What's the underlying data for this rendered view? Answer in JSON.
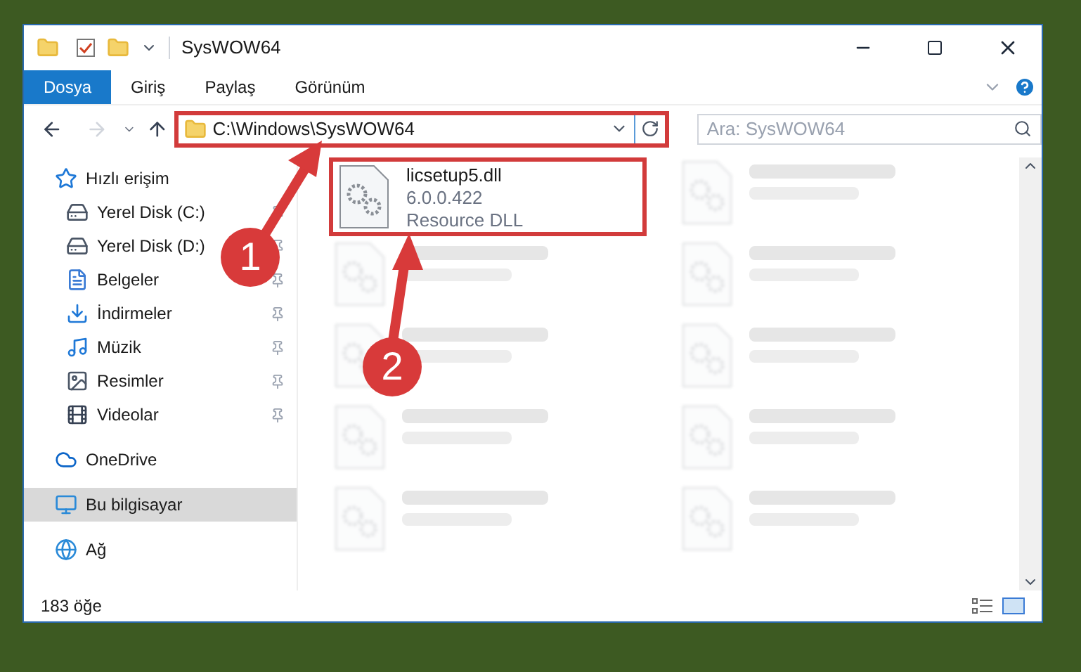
{
  "window": {
    "title": "SysWOW64"
  },
  "ribbon_tabs": [
    {
      "label": "Dosya",
      "selected": true
    },
    {
      "label": "Giriş",
      "selected": false
    },
    {
      "label": "Paylaş",
      "selected": false
    },
    {
      "label": "Görünüm",
      "selected": false
    }
  ],
  "address": {
    "path": "C:\\Windows\\SysWOW64",
    "highlighted": true
  },
  "search": {
    "placeholder": "Ara: SysWOW64"
  },
  "sidebar": {
    "items": [
      {
        "label": "Hızlı erişim",
        "kind": "star",
        "selected": false,
        "children": [
          {
            "label": "Yerel Disk (C:)",
            "kind": "disk-c",
            "pinned": true,
            "selected": false
          },
          {
            "label": "Yerel Disk (D:)",
            "kind": "disk",
            "pinned": true,
            "selected": false
          },
          {
            "label": "Belgeler",
            "kind": "docs",
            "pinned": true,
            "selected": false
          },
          {
            "label": "İndirmeler",
            "kind": "download",
            "pinned": true,
            "selected": false
          },
          {
            "label": "Müzik",
            "kind": "music",
            "pinned": true,
            "selected": false
          },
          {
            "label": "Resimler",
            "kind": "pictures",
            "pinned": true,
            "selected": false
          },
          {
            "label": "Videolar",
            "kind": "videos",
            "pinned": true,
            "selected": false
          }
        ]
      },
      {
        "label": "OneDrive",
        "kind": "cloud",
        "selected": false
      },
      {
        "label": "Bu bilgisayar",
        "kind": "pc",
        "selected": true
      },
      {
        "label": "Ağ",
        "kind": "network",
        "selected": false
      }
    ]
  },
  "files": [
    {
      "name": "licsetup5.dll",
      "version": "6.0.0.422",
      "type": "Resource DLL",
      "highlighted": true,
      "blurred": false
    },
    {
      "blurred": true
    },
    {
      "blurred": true
    },
    {
      "blurred": true
    },
    {
      "blurred": true
    },
    {
      "blurred": true
    },
    {
      "blurred": true
    },
    {
      "blurred": true
    },
    {
      "blurred": true
    },
    {
      "blurred": true
    }
  ],
  "status_bar": {
    "count": "183 öğe"
  },
  "annotations": [
    {
      "number": "1",
      "kind": "arrow-up-right"
    },
    {
      "number": "2",
      "kind": "arrow-up"
    }
  ]
}
